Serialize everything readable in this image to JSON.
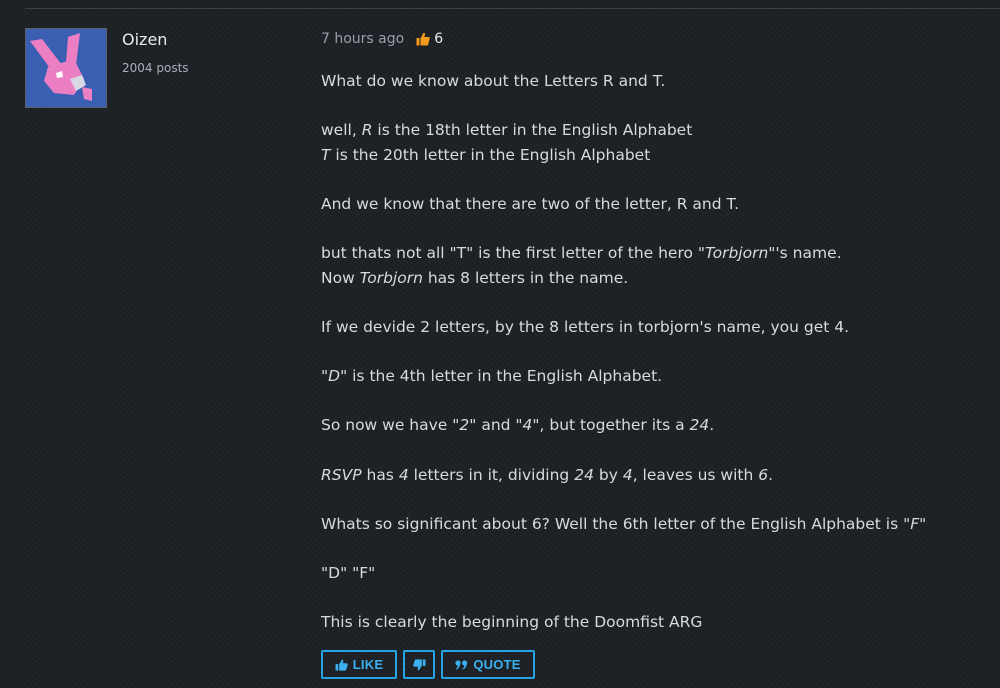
{
  "post": {
    "author": {
      "name": "Oizen",
      "post_count": "2004 posts",
      "avatar_icon": "pink-bunny-icon"
    },
    "timestamp": "7 hours ago",
    "like_count": "6",
    "body": {
      "p1": "What do we know about the Letters R and T.",
      "p2": {
        "l1_em": "R",
        "l1_text": " is the 18th letter in the English Alphabet",
        "l1_prefix": "well, ",
        "l2_em": "T",
        "l2_text": " is the 20th letter in the English Alphabet"
      },
      "p3": "And we know that there are two of the letter, R and T.",
      "p4": {
        "a": "but thats not all \"T\" is the first letter of the hero ",
        "b_em": "\"Torbjorn\"",
        "c": "'s name.",
        "d": "Now ",
        "e_em": "Torbjorn",
        "f": " has 8 letters in the name."
      },
      "p5": "If we devide 2 letters, by the 8 letters in torbjorn's name, you get 4.",
      "p6": {
        "a_em": "\"D\"",
        "b": " is the 4th letter in the English Alphabet."
      },
      "p7": {
        "a": "So now we have ",
        "b_em": "\"2\"",
        "c": " and ",
        "d_em": "\"4\"",
        "e": ", but together its a ",
        "f_em": "24",
        "g": "."
      },
      "p8": {
        "a_em": "RSVP",
        "b": " has ",
        "c_em": "4",
        "d": " letters in it, dividing ",
        "e_em": "24",
        "f": " by ",
        "g_em": "4",
        "h": ", leaves us with ",
        "i_em": "6",
        "j": "."
      },
      "p9": {
        "a": "Whats so significant about 6? Well the 6th letter of the English Alphabet is ",
        "b_em": "\"F\""
      },
      "p10": "\"D\" \"F\"",
      "p11": "This is clearly the beginning of the Doomfist ARG"
    },
    "actions": {
      "like_label": "LIKE",
      "quote_label": "QUOTE"
    }
  },
  "colors": {
    "background": "#1c1f24",
    "accent_blue": "#27a3e3",
    "like_orange": "#f59a1c",
    "avatar_bg": "#3a5fb2",
    "bunny_pink": "#ec7fc4"
  }
}
